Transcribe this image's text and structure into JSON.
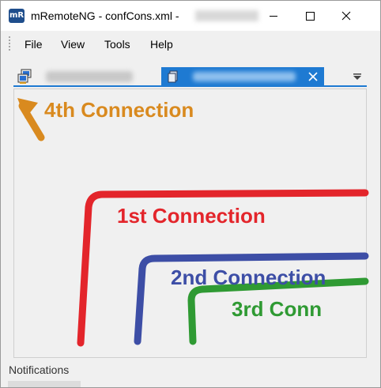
{
  "window": {
    "app_icon_text": "mR",
    "title": "mRemoteNG - confCons.xml -"
  },
  "menu": {
    "items": [
      "File",
      "View",
      "Tools",
      "Help"
    ]
  },
  "tabs": {
    "active_tab_close_glyph": "✕",
    "dropdown_icon": "chevron-down-icon"
  },
  "annotations": [
    {
      "text": "4th Connection",
      "color": "#d98a1f"
    },
    {
      "text": "1st Connection",
      "color": "#e3252b"
    },
    {
      "text": "2nd Connection",
      "color": "#3d4ea6"
    },
    {
      "text": "3rd Conn",
      "color": "#2f9a33"
    }
  ],
  "notifications": {
    "label": "Notifications"
  }
}
